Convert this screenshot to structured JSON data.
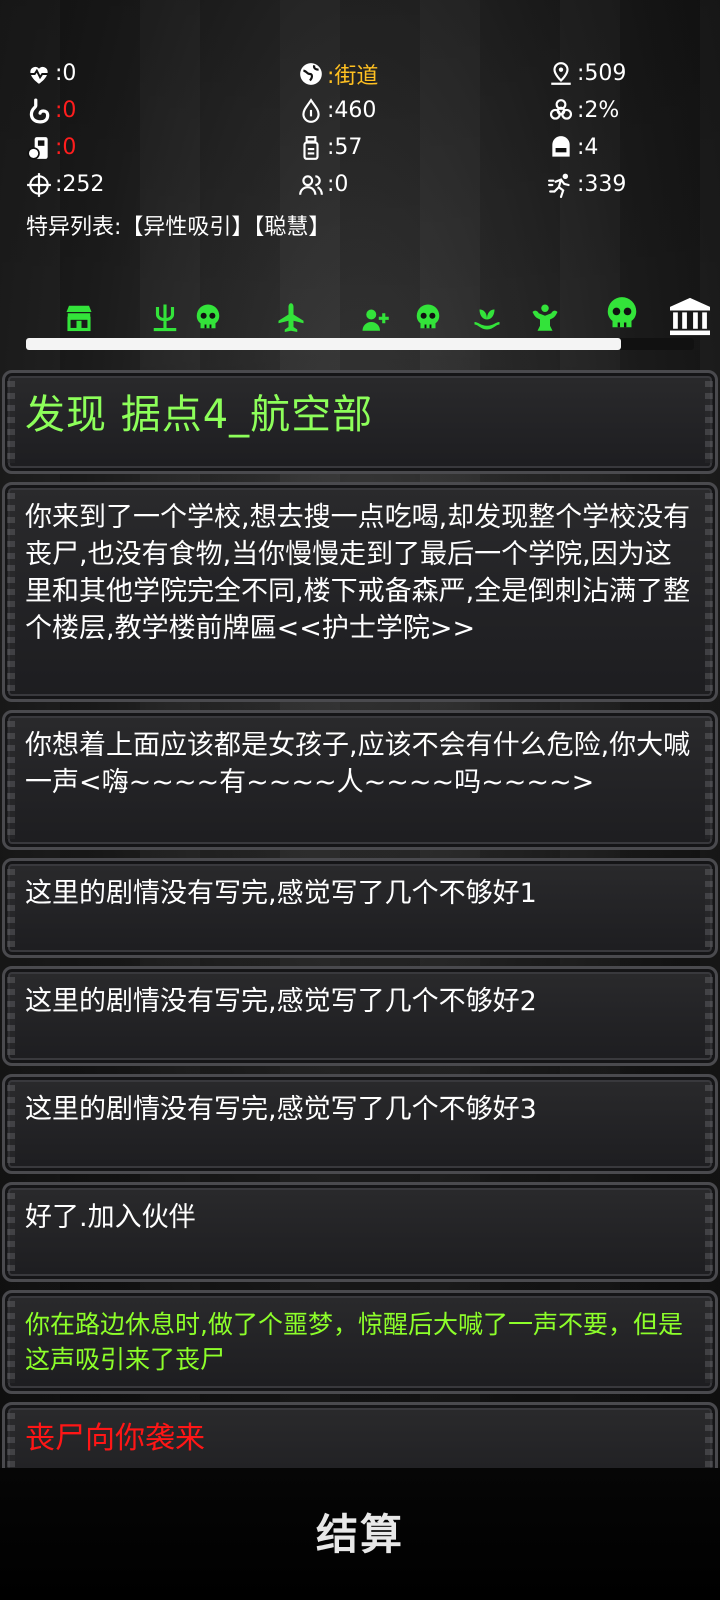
{
  "stats": {
    "health": ":0",
    "location": ":街道",
    "distance": ":509",
    "hunger": ":0",
    "water": ":460",
    "infection": ":2%",
    "supplies": ":0",
    "medicine": ":57",
    "armor": ":4",
    "accuracy": ":252",
    "companions": ":0",
    "speed": ":339"
  },
  "traits_text": "特异列表:【异性吸引】【聪慧】",
  "progress": 0.89,
  "colors": {
    "accent_green": "#8dff2a",
    "title_green": "#8dff5a",
    "warning_red": "#ff1d1d",
    "location_yellow": "#ffc021",
    "icon_green": "#33e33a"
  },
  "event_icons": [
    "shop-icon",
    "trident-icon",
    "skull-icon",
    "airplane-icon",
    "add-person-icon",
    "skull-icon",
    "plant-hand-icon",
    "strongman-icon",
    "boss-skull-icon",
    "bank-icon"
  ],
  "log": {
    "title": "发现 据点4_航空部",
    "entries": [
      "你来到了一个学校,想去搜一点吃喝,却发现整个学校没有丧尸,也没有食物,当你慢慢走到了最后一个学院,因为这里和其他学院完全不同,楼下戒备森严,全是倒刺沾满了整个楼层,教学楼前牌匾<<护士学院>>",
      "你想着上面应该都是女孩子,应该不会有什么危险,你大喊一声<嗨~~~~有~~~~人~~~~吗~~~~>",
      "这里的剧情没有写完,感觉写了几个不够好1",
      "这里的剧情没有写完,感觉写了几个不够好2",
      "这里的剧情没有写完,感觉写了几个不够好3",
      "好了.加入伙伴"
    ],
    "nightmare": "你在路边休息时,做了个噩梦，惊醒后大喊了一声不要，但是这声吸引来了丧尸",
    "danger": "丧尸向你袭来"
  },
  "settle_button": "结算"
}
